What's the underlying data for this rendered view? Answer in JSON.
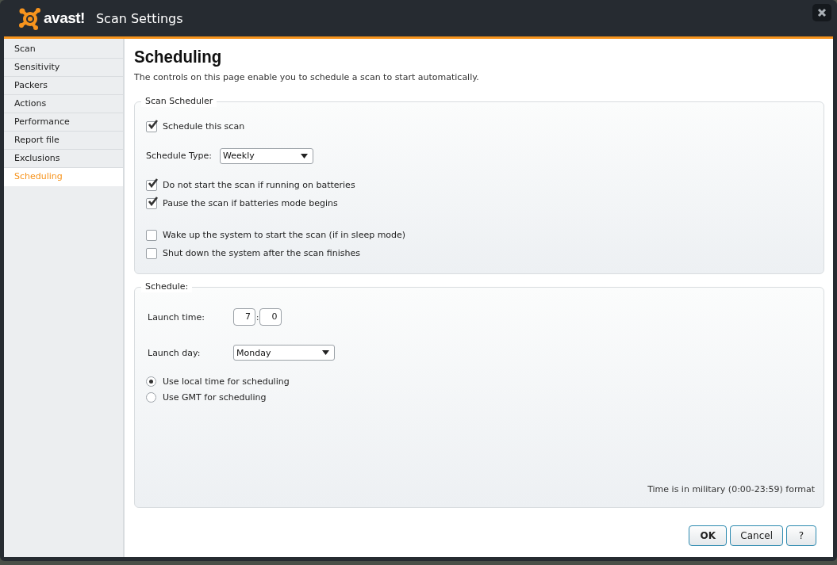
{
  "window": {
    "logo_text": "avast!",
    "title": "Scan Settings"
  },
  "sidebar": {
    "items": [
      {
        "label": "Scan",
        "selected": false
      },
      {
        "label": "Sensitivity",
        "selected": false
      },
      {
        "label": "Packers",
        "selected": false
      },
      {
        "label": "Actions",
        "selected": false
      },
      {
        "label": "Performance",
        "selected": false
      },
      {
        "label": "Report file",
        "selected": false
      },
      {
        "label": "Exclusions",
        "selected": false
      },
      {
        "label": "Scheduling",
        "selected": true
      }
    ]
  },
  "page": {
    "heading": "Scheduling",
    "description": "The controls on this page enable you to schedule a scan to start automatically."
  },
  "scan_scheduler": {
    "legend": "Scan Scheduler",
    "rows": [
      {
        "kind": "checkbox",
        "label": "Schedule this scan",
        "checked": true
      },
      {
        "kind": "dropdown",
        "label": "Schedule Type:",
        "value": "Weekly"
      },
      {
        "kind": "checkbox",
        "label": "Do not start the scan if running on batteries",
        "checked": true
      },
      {
        "kind": "checkbox",
        "label": "Pause the scan if batteries mode begins",
        "checked": true
      },
      {
        "kind": "checkbox",
        "label": "Wake up the system to start the scan (if in sleep mode)",
        "checked": false
      },
      {
        "kind": "checkbox",
        "label": "Shut down the system after the scan finishes",
        "checked": false
      }
    ]
  },
  "schedule": {
    "legend": "Schedule:",
    "launch_time": {
      "label": "Launch time:",
      "hours": "7",
      "separator": ":",
      "minutes": "0"
    },
    "launch_day": {
      "label": "Launch day:",
      "value": "Monday"
    },
    "time_options": [
      {
        "label": "Use local time for scheduling",
        "selected": true
      },
      {
        "label": "Use GMT for scheduling",
        "selected": false
      }
    ],
    "note": "Time is in military (0:00-23:59) format"
  },
  "buttons": [
    {
      "label": "OK",
      "kind": "default"
    },
    {
      "label": "Cancel",
      "kind": "normal"
    },
    {
      "label": "?",
      "kind": "normal"
    }
  ]
}
